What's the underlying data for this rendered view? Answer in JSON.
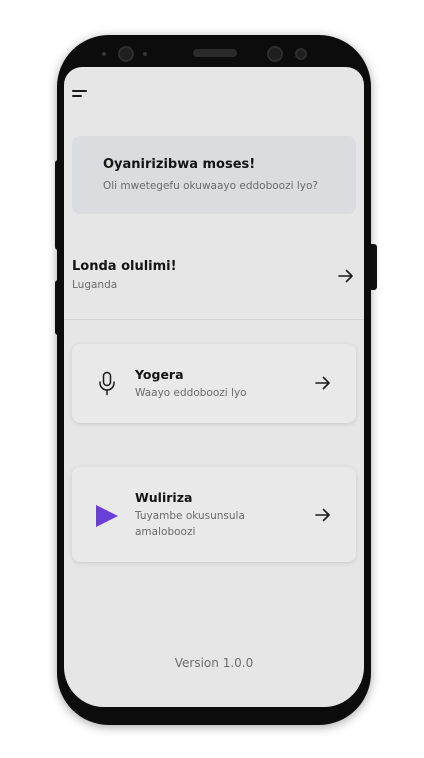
{
  "welcome": {
    "title": "Oyanirizibwa moses!",
    "subtitle": "Oli mwetegefu okuwaayo eddoboozi lyo?"
  },
  "language": {
    "title": "Londa olulimi!",
    "selected": "Luganda"
  },
  "actions": [
    {
      "title": "Yogera",
      "subtitle": "Waayo eddoboozi lyo",
      "icon": "microphone-icon"
    },
    {
      "title": "Wuliriza",
      "subtitle": "Tuyambe okusunsula amaloboozi",
      "icon": "play-icon",
      "icon_color": "#6a3fd6"
    }
  ],
  "footer": {
    "version": "Version 1.0.0"
  },
  "colors": {
    "screen_bg": "#e6e6e6",
    "card_bg": "#dadcdf",
    "accent": "#6a3fd6"
  }
}
